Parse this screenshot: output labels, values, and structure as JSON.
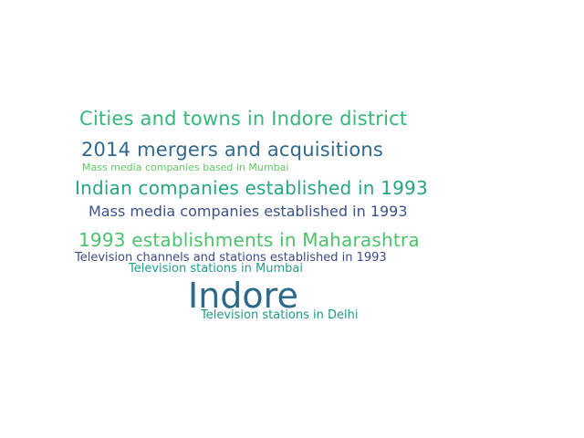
{
  "word_cloud": {
    "words": [
      {
        "id": "w1",
        "text": "Cities and towns in Indore district",
        "color": "#35b779"
      },
      {
        "id": "w2",
        "text": "2014 mergers and acquisitions",
        "color": "#31688e"
      },
      {
        "id": "w3",
        "text": "Mass media companies based in Mumbai",
        "color": "#5ec962"
      },
      {
        "id": "w4",
        "text": "Indian companies established in 1993",
        "color": "#26a67e"
      },
      {
        "id": "w5",
        "text": "Mass media companies established in 1993",
        "color": "#3b528b"
      },
      {
        "id": "w6",
        "text": "1993 establishments in Maharashtra",
        "color": "#4cc26c"
      },
      {
        "id": "w7",
        "text": "Television channels and stations established in 1993",
        "color": "#3e4a89"
      },
      {
        "id": "w8",
        "text": "Television stations in Mumbai",
        "color": "#1f9e89"
      },
      {
        "id": "w9",
        "text": "Indore",
        "color": "#2c6a8a"
      },
      {
        "id": "w10",
        "text": "Television stations in Delhi",
        "color": "#1f9a8a"
      }
    ]
  }
}
